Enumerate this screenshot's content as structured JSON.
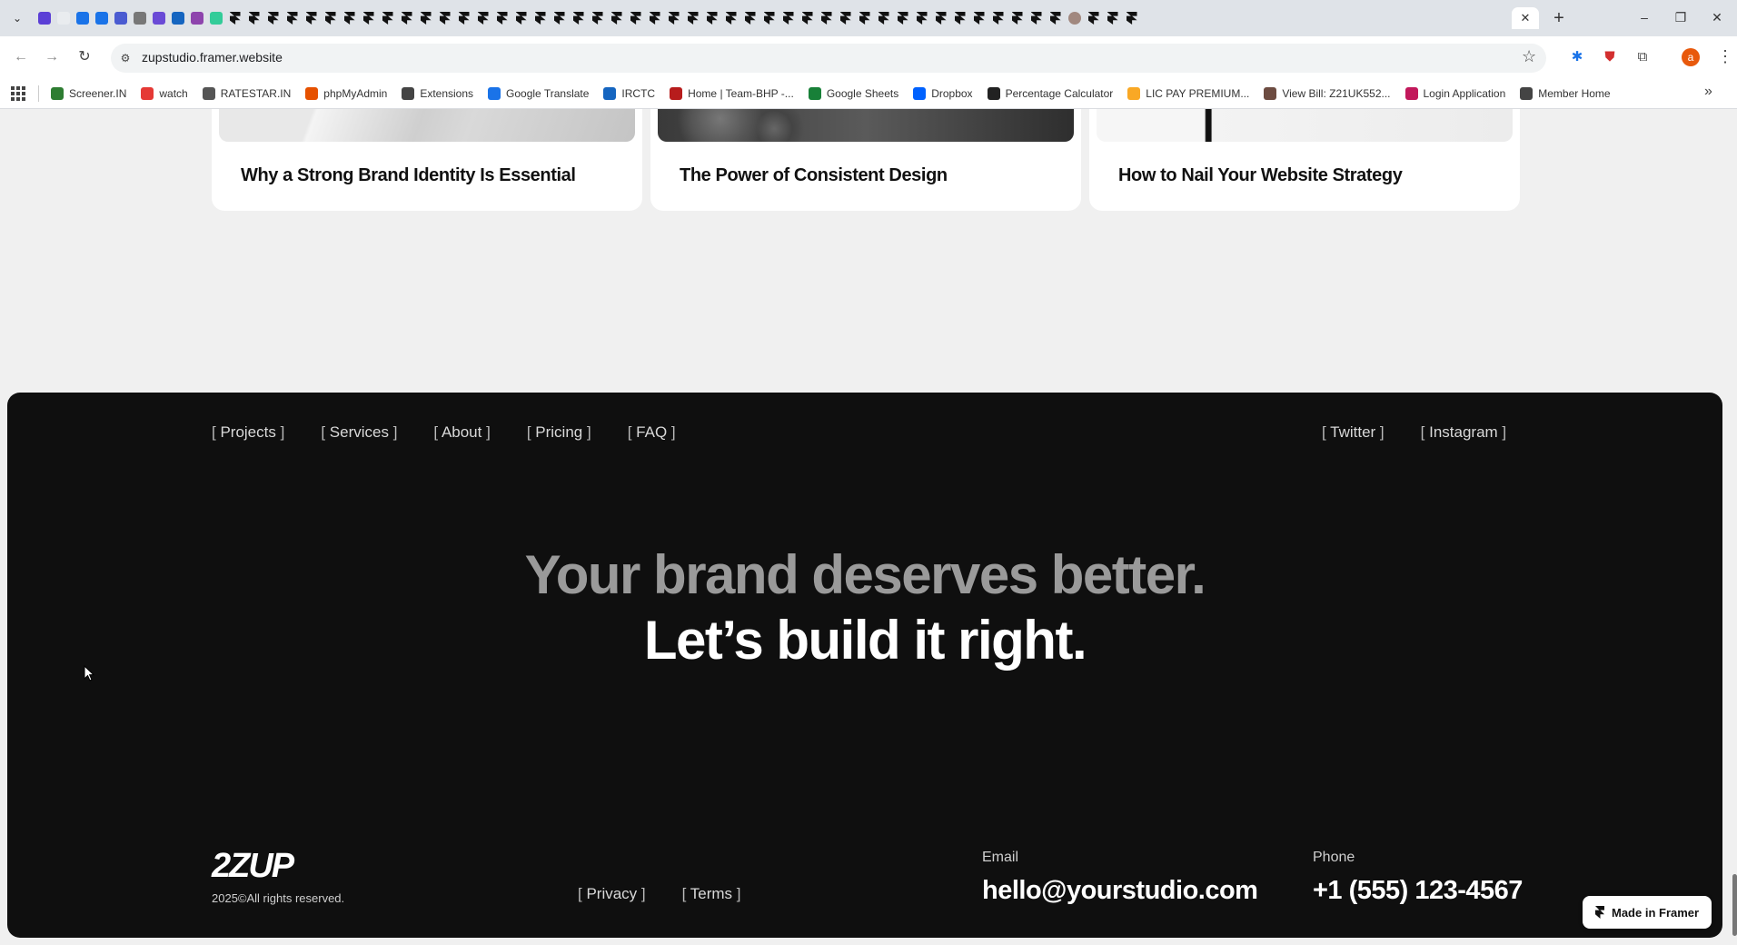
{
  "browser": {
    "url": "zupstudio.framer.website",
    "tab_close": "✕",
    "new_tab": "+",
    "window_controls": {
      "minimize": "–",
      "restore": "❐",
      "close": "✕"
    },
    "avatar_letter": "a",
    "favicon_tabs_count_note": "",
    "bookmarks": [
      {
        "label": "Screener.IN",
        "icon": "bar-chart-icon",
        "color": "#2e7d32"
      },
      {
        "label": "watch",
        "icon": "youtube-icon",
        "color": "#e53935"
      },
      {
        "label": "RATESTAR.IN",
        "icon": "ratestar-icon",
        "color": "#555555"
      },
      {
        "label": "phpMyAdmin",
        "icon": "phpmyadmin-icon",
        "color": "#e65100"
      },
      {
        "label": "Extensions",
        "icon": "puzzle-icon",
        "color": "#444444"
      },
      {
        "label": "Google Translate",
        "icon": "translate-icon",
        "color": "#1a73e8"
      },
      {
        "label": "IRCTC",
        "icon": "irctc-icon",
        "color": "#1565c0"
      },
      {
        "label": "Home | Team-BHP -...",
        "icon": "teambhp-icon",
        "color": "#b71c1c"
      },
      {
        "label": "Google Sheets",
        "icon": "sheets-icon",
        "color": "#188038"
      },
      {
        "label": "Dropbox",
        "icon": "dropbox-icon",
        "color": "#0061fe"
      },
      {
        "label": "Percentage Calculator",
        "icon": "percent-icon",
        "color": "#222222"
      },
      {
        "label": "LIC PAY PREMIUM...",
        "icon": "lic-icon",
        "color": "#f9a825"
      },
      {
        "label": "View Bill: Z21UK552...",
        "icon": "bill-icon",
        "color": "#6d4c41"
      },
      {
        "label": "Login Application",
        "icon": "login-icon",
        "color": "#c2185b"
      },
      {
        "label": "Member Home",
        "icon": "globe-icon",
        "color": "#444444"
      }
    ]
  },
  "cards": [
    {
      "title": "Why a Strong Brand Identity Is Essential"
    },
    {
      "title": "The Power of Consistent Design"
    },
    {
      "title": "How to Nail Your Website Strategy"
    }
  ],
  "footer": {
    "nav": [
      "Projects",
      "Services",
      "About",
      "Pricing",
      "FAQ"
    ],
    "social": [
      "Twitter",
      "Instagram"
    ],
    "headline_line1": "Your brand deserves better.",
    "headline_line2": "Let’s build it right.",
    "logo": "2ZUP",
    "copyright": "2025©All rights reserved.",
    "legal": [
      "Privacy",
      "Terms"
    ],
    "email_label": "Email",
    "email": "hello@yourstudio.com",
    "phone_label": "Phone",
    "phone": "+1 (555) 123-4567",
    "framer_badge": "Made in Framer"
  },
  "colors": {
    "footer_bg": "#0f0f0f",
    "headline_muted": "#9a9a9a",
    "page_bg": "#f0f0f0"
  }
}
